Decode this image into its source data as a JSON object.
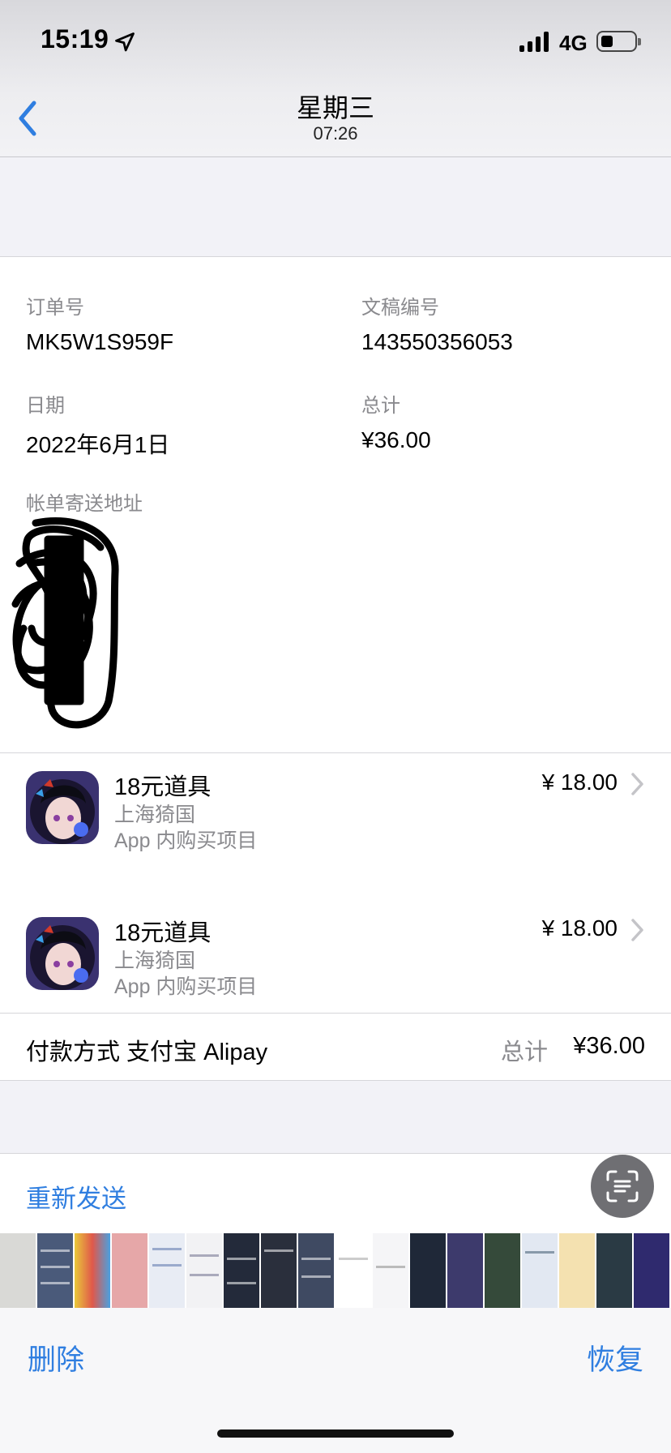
{
  "status_bar": {
    "time": "15:19",
    "network": "4G"
  },
  "nav": {
    "title": "星期三",
    "subtitle": "07:26",
    "back_icon": "chevron-left-icon"
  },
  "order": {
    "order_no_label": "订单号",
    "order_no": "MK5W1S959F",
    "doc_no_label": "文稿编号",
    "doc_no": "143550356053",
    "date_label": "日期",
    "date": "2022年6月1日",
    "total_label": "总计",
    "total": "¥36.00",
    "billing_label": "帐单寄送地址"
  },
  "items": [
    {
      "title": "18元道具",
      "developer": "上海猗国",
      "kind": "App 内购买项目",
      "price": "¥ 18.00"
    },
    {
      "title": "18元道具",
      "developer": "上海猗国",
      "kind": "App 内购买项目",
      "price": "¥ 18.00"
    }
  ],
  "payment": {
    "label": "付款方式 支付宝 Alipay",
    "total_label": "总计",
    "total_value": "¥36.00"
  },
  "actions": {
    "resend": "重新发送",
    "delete": "删除",
    "restore": "恢复"
  },
  "colors": {
    "accent": "#2f7ee0",
    "secondary_text": "#8a8a8e",
    "background": "#f2f2f7"
  }
}
